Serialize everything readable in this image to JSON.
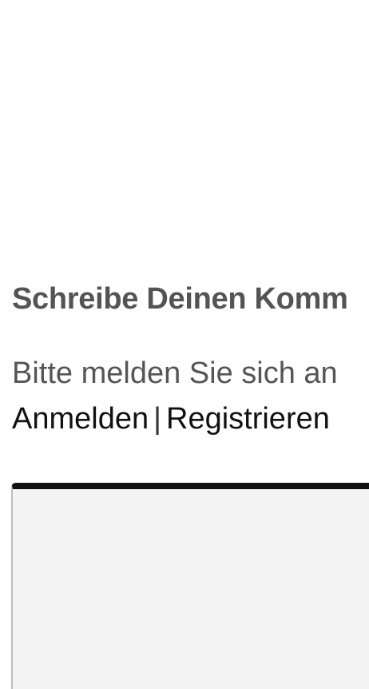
{
  "comments": {
    "heading": "Schreibe Deinen Komm",
    "login_hint": "Bitte melden Sie sich an",
    "login_link": "Anmelden",
    "separator": "|",
    "register_link": "Registrieren"
  },
  "colors": {
    "heading": "#545454",
    "hint_text": "#555555",
    "link_text": "#111111",
    "editor_background": "#f4f4f4",
    "editor_top_border": "#111111"
  }
}
